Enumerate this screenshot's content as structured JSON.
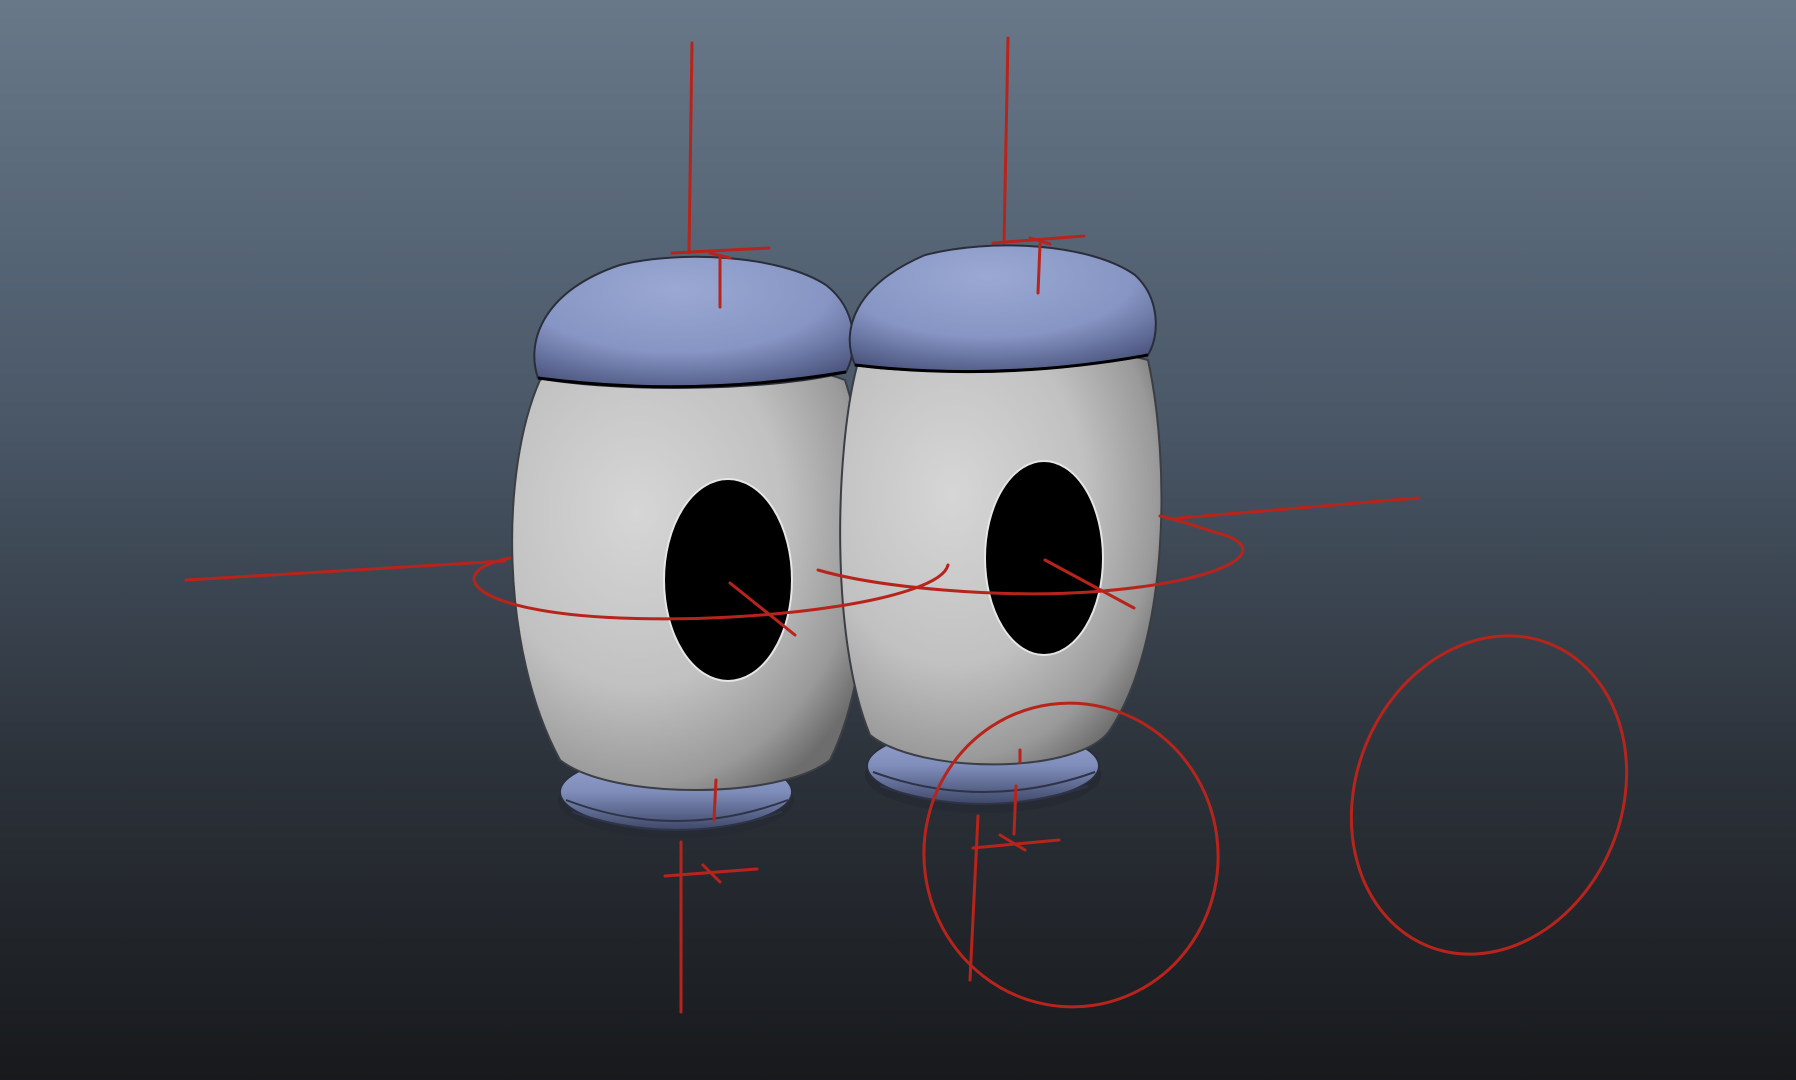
{
  "viewport": {
    "background_top": "#687889",
    "background_bottom": "#17191c"
  },
  "colors": {
    "eye_white": "#cccccc",
    "eye_white_shadow": "#6d6d6d",
    "lid": "#8d9cc9",
    "lid_shadow": "#4c5680",
    "pupil": "#000000",
    "rig_control": "#b7241c"
  },
  "objects": {
    "eyes": [
      "left-eye",
      "right-eye"
    ],
    "controls": [
      "aim-control-near",
      "aim-control-far"
    ]
  }
}
